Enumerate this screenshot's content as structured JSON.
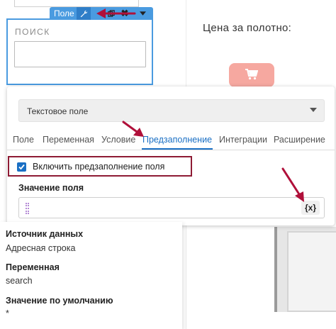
{
  "background": {
    "price_label": "Цена за полотно:",
    "cart_button_icon": "cart-icon",
    "door_image_icon": "door-image"
  },
  "field_widget": {
    "label": "ПОИСК",
    "toolbar": {
      "label": "Поле",
      "icons": [
        "wrench-icon",
        "copy-icon",
        "close-icon",
        "chevron-down-icon"
      ],
      "color": "#4a9be0"
    }
  },
  "settings": {
    "field_type": "Текстовое поле",
    "tabs": [
      "Поле",
      "Переменная",
      "Условие",
      "Предзаполнение",
      "Интеграции",
      "Расширение"
    ],
    "active_tab": "Предзаполнение",
    "prefill_checkbox_label": "Включить предзаполнение поля",
    "prefill_checked": true,
    "value_label": "Значение поля",
    "value_input": "",
    "variable_button": "{x}"
  },
  "tooltip": {
    "source_label": "Источник данных",
    "source_value": "Адресная строка",
    "variable_label": "Переменная",
    "variable_value": "search",
    "default_label": "Значение по умолчанию",
    "default_value": "*"
  },
  "colors": {
    "accent": "#1a6fc4",
    "highlight_box": "#8e1b34",
    "annotation_arrow": "#b0103a",
    "cart_button": "#f6a8a0"
  }
}
